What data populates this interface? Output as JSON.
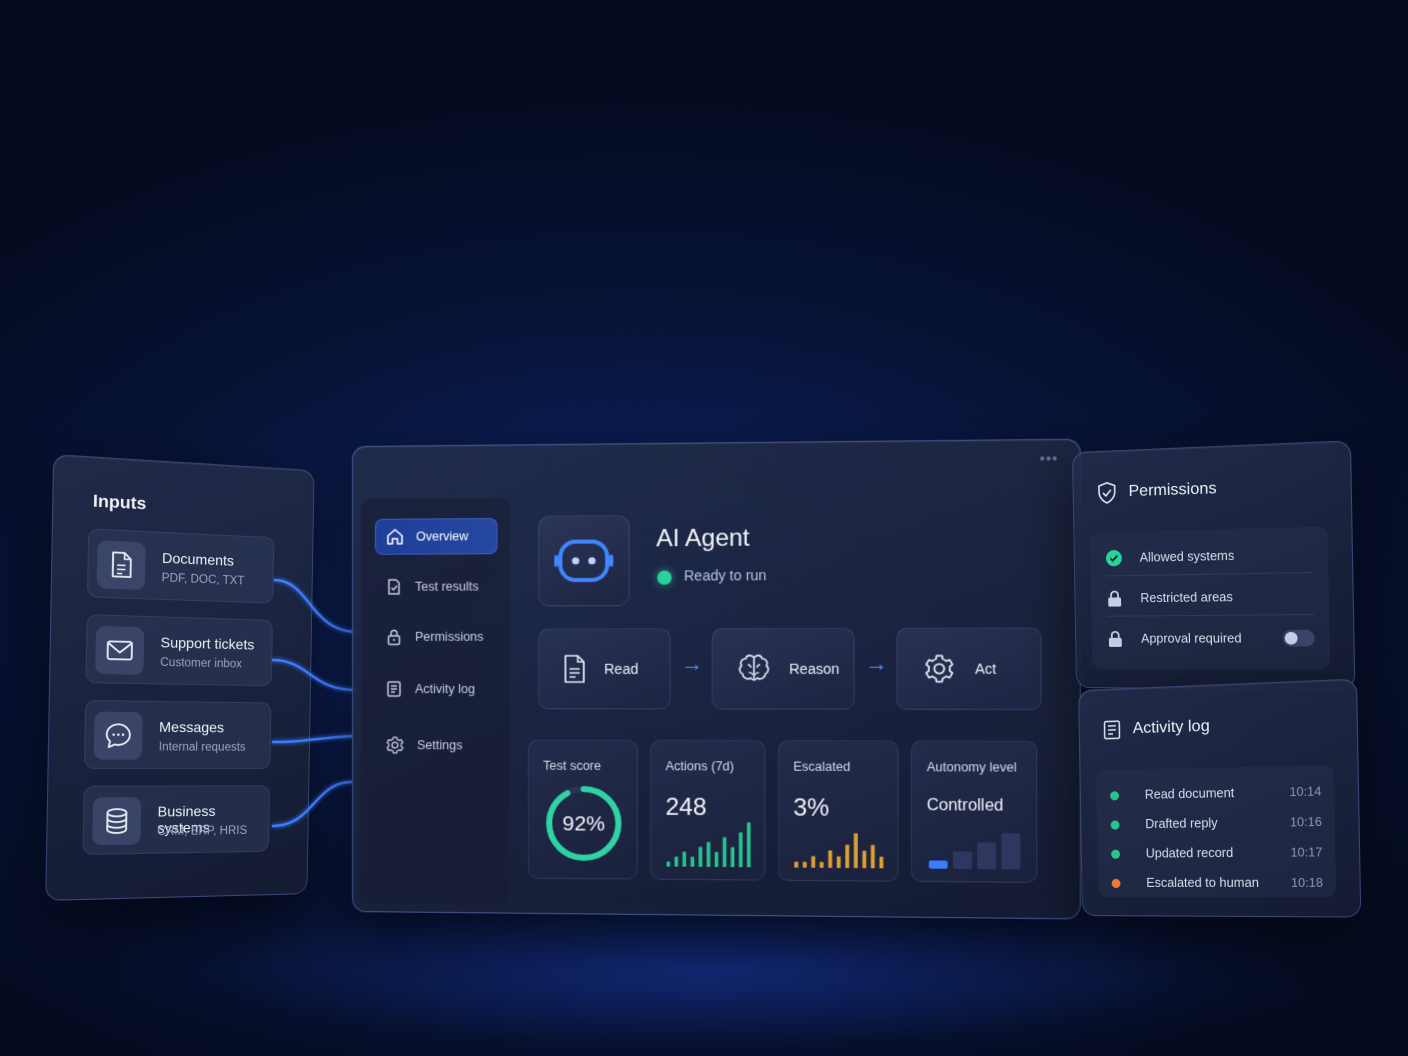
{
  "inputs": {
    "title": "Inputs",
    "items": [
      {
        "icon": "document-icon",
        "label": "Documents",
        "sub": "PDF, DOC, TXT"
      },
      {
        "icon": "mail-icon",
        "label": "Support tickets",
        "sub": "Customer inbox"
      },
      {
        "icon": "chat-bubble-icon",
        "label": "Messages",
        "sub": "Internal requests"
      },
      {
        "icon": "database-icon",
        "label": "Business systems",
        "sub": "CRM, ERP, HRIS"
      }
    ]
  },
  "window": {
    "menu_dots": "•••"
  },
  "sidebar": {
    "items": [
      {
        "icon": "home-icon",
        "label": "Overview",
        "active": true
      },
      {
        "icon": "test-results-icon",
        "label": "Test results"
      },
      {
        "icon": "lock-icon",
        "label": "Permissions"
      },
      {
        "icon": "list-icon",
        "label": "Activity log"
      },
      {
        "icon": "gear-icon",
        "label": "Settings"
      }
    ]
  },
  "agent": {
    "icon": "robot-face-icon",
    "title": "AI Agent",
    "status": "Ready to run",
    "status_color": "#27d39a"
  },
  "workflow": {
    "steps": [
      {
        "icon": "document-icon",
        "label": "Read"
      },
      {
        "icon": "brain-icon",
        "label": "Reason"
      },
      {
        "icon": "gear-icon",
        "label": "Act"
      }
    ],
    "arrow": "→"
  },
  "metrics": {
    "test_score": {
      "label": "Test score",
      "value": "92%",
      "fraction": 0.92,
      "color": "#2fd2a6"
    },
    "actions": {
      "label": "Actions (7d)",
      "value": "248",
      "color": "#27c58e",
      "bars": [
        1,
        2,
        3,
        2,
        4,
        5,
        3,
        6,
        4,
        7,
        9
      ]
    },
    "escalated": {
      "label": "Escalated",
      "value": "3%",
      "color": "#e0a030",
      "bars": [
        1,
        1,
        2,
        1,
        3,
        2,
        4,
        6,
        3,
        4,
        2
      ]
    },
    "autonomy": {
      "label": "Autonomy level",
      "value": "Controlled",
      "color": "#3a7bff",
      "levels": 4,
      "active_level": 1
    }
  },
  "permissions": {
    "title": "Permissions",
    "icon": "shield-check-icon",
    "rows": [
      {
        "icon": "check-circle-icon",
        "label": "Allowed systems",
        "color": "#27d39a"
      },
      {
        "icon": "lock-icon",
        "label": "Restricted areas"
      },
      {
        "icon": "lock-icon",
        "label": "Approval required",
        "toggle": false
      }
    ]
  },
  "activity": {
    "title": "Activity log",
    "icon": "list-icon",
    "rows": [
      {
        "label": "Read document",
        "time": "10:14",
        "color": "#27c58e"
      },
      {
        "label": "Drafted reply",
        "time": "10:16",
        "color": "#27c58e"
      },
      {
        "label": "Updated record",
        "time": "10:17",
        "color": "#27c58e"
      },
      {
        "label": "Escalated to human",
        "time": "10:18",
        "color": "#f07a3a"
      }
    ]
  }
}
